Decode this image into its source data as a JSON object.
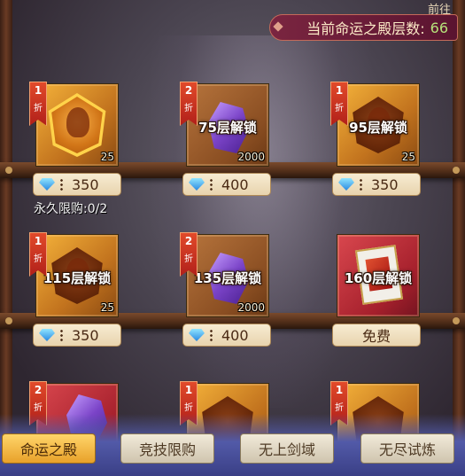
{
  "header": {
    "top_cut_text": "前往",
    "layers_label": "当前命运之殿层数:",
    "layers_value": "66"
  },
  "rows": [
    {
      "items": [
        {
          "discount": "1",
          "discount_unit": "折",
          "tile": "gold",
          "icon": "hero-shard-icon",
          "lock_text": "",
          "count": "25",
          "price": "350"
        },
        {
          "discount": "2",
          "discount_unit": "折",
          "tile": "brown",
          "icon": "purple-crystal-icon",
          "lock_text": "75层解锁",
          "count": "2000",
          "price": "400"
        },
        {
          "discount": "1",
          "discount_unit": "折",
          "tile": "gold",
          "icon": "hero-shard-icon",
          "lock_text": "95层解锁",
          "count": "25",
          "price": "350"
        }
      ]
    },
    {
      "items": [
        {
          "discount": "1",
          "discount_unit": "折",
          "tile": "gold",
          "icon": "hero-shard-icon",
          "lock_text": "115层解锁",
          "count": "25",
          "price": "350"
        },
        {
          "discount": "2",
          "discount_unit": "折",
          "tile": "brown",
          "icon": "purple-crystal-icon",
          "lock_text": "135层解锁",
          "count": "2000",
          "price": "400"
        },
        {
          "discount": "",
          "discount_unit": "",
          "tile": "red",
          "icon": "card-pack-icon",
          "lock_text": "160层解锁",
          "count": "",
          "price": "免费"
        }
      ]
    },
    {
      "items": [
        {
          "discount": "2",
          "discount_unit": "折",
          "tile": "red",
          "icon": "purple-crystal-icon"
        },
        {
          "discount": "1",
          "discount_unit": "折",
          "tile": "gold",
          "icon": "hero-shard-icon"
        },
        {
          "discount": "1",
          "discount_unit": "折",
          "tile": "gold",
          "icon": "hero-shard-icon"
        }
      ]
    }
  ],
  "limit_text": "永久限购:0/2",
  "tabs": [
    {
      "label": "命运之殿",
      "active": true
    },
    {
      "label": "竞技限购",
      "active": false
    },
    {
      "label": "无上剑域",
      "active": false
    },
    {
      "label": "无尽试炼",
      "active": false
    }
  ],
  "colors": {
    "accent": "#b6e27a",
    "tab_active": "#e8a12a",
    "price_bg": "#f7ecd2"
  }
}
